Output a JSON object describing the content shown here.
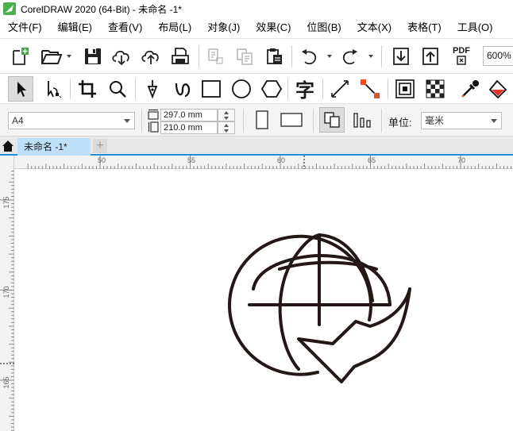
{
  "window": {
    "title": "CorelDRAW 2020 (64-Bit) - 未命名 -1*"
  },
  "menu": [
    "文件(F)",
    "编辑(E)",
    "查看(V)",
    "布局(L)",
    "对象(J)",
    "效果(C)",
    "位图(B)",
    "文本(X)",
    "表格(T)",
    "工具(O)"
  ],
  "toolbar": {
    "pdf_label": "PDF",
    "zoom_value": "600%"
  },
  "toolbox": {
    "text_tool_glyph": "字"
  },
  "propbar": {
    "page_size": "A4",
    "width": "297.0 mm",
    "height": "210.0 mm",
    "unit_label": "单位:",
    "unit_value": "毫米"
  },
  "tabs": {
    "doc_tab": "未命名 -1*",
    "add_tab": "+"
  },
  "rulers": {
    "h_labels": [
      "50",
      "55",
      "60",
      "65",
      "70"
    ],
    "v_labels": [
      "175",
      "170",
      "165"
    ]
  },
  "icons": {
    "app_logo": "coreldraw-logo",
    "globe": "globe-arrow-icon"
  }
}
